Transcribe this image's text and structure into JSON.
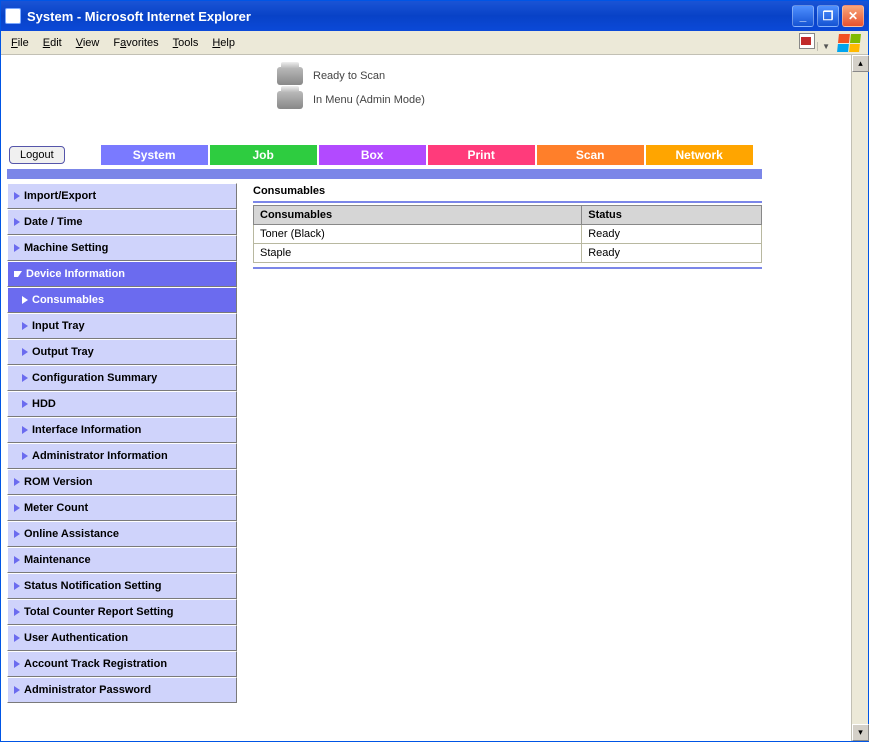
{
  "window": {
    "title": "System - Microsoft Internet Explorer"
  },
  "menubar": {
    "items": [
      "File",
      "Edit",
      "View",
      "Favorites",
      "Tools",
      "Help"
    ]
  },
  "status": {
    "line1": "Ready to Scan",
    "line2": "In Menu (Admin Mode)"
  },
  "logout_label": "Logout",
  "tabs": {
    "system": "System",
    "job": "Job",
    "box": "Box",
    "print": "Print",
    "scan": "Scan",
    "network": "Network"
  },
  "sidebar": {
    "items": [
      {
        "label": "Import/Export"
      },
      {
        "label": "Date / Time"
      },
      {
        "label": "Machine Setting"
      },
      {
        "label": "Device Information",
        "selected": true,
        "expanded": true
      },
      {
        "label": "Consumables",
        "sub": true,
        "selected": true
      },
      {
        "label": "Input Tray",
        "sub": true
      },
      {
        "label": "Output Tray",
        "sub": true
      },
      {
        "label": "Configuration Summary",
        "sub": true
      },
      {
        "label": "HDD",
        "sub": true
      },
      {
        "label": "Interface Information",
        "sub": true
      },
      {
        "label": "Administrator Information",
        "sub": true
      },
      {
        "label": "ROM Version"
      },
      {
        "label": "Meter Count"
      },
      {
        "label": "Online Assistance"
      },
      {
        "label": "Maintenance"
      },
      {
        "label": "Status Notification Setting"
      },
      {
        "label": "Total Counter Report Setting"
      },
      {
        "label": "User Authentication"
      },
      {
        "label": "Account Track Registration"
      },
      {
        "label": "Administrator Password"
      }
    ]
  },
  "main": {
    "title": "Consumables",
    "headers": {
      "col1": "Consumables",
      "col2": "Status"
    },
    "rows": [
      {
        "name": "Toner (Black)",
        "status": "Ready"
      },
      {
        "name": "Staple",
        "status": "Ready"
      }
    ]
  }
}
